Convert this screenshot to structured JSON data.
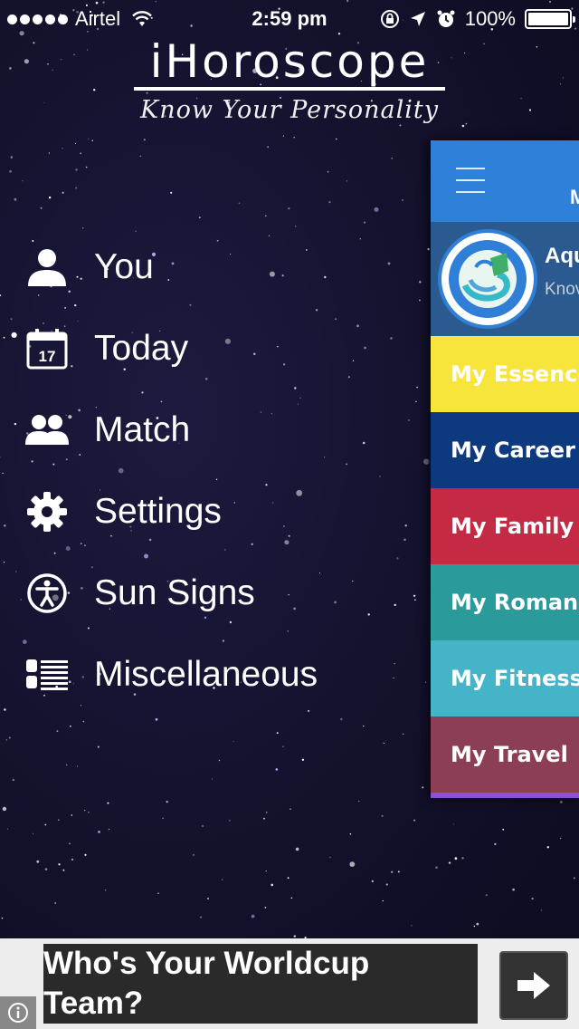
{
  "status_bar": {
    "carrier": "Airtel",
    "time": "2:59 pm",
    "battery": "100%"
  },
  "app": {
    "title": "iHoroscope",
    "tagline": "Know Your Personality"
  },
  "menu": {
    "items": [
      {
        "label": "You",
        "icon": "person-icon"
      },
      {
        "label": "Today",
        "icon": "calendar-icon",
        "icon_text": "17"
      },
      {
        "label": "Match",
        "icon": "people-icon"
      },
      {
        "label": "Settings",
        "icon": "gear-icon"
      },
      {
        "label": "Sun Signs",
        "icon": "accessibility-icon"
      },
      {
        "label": "Miscellaneous",
        "icon": "list-icon"
      }
    ]
  },
  "panel": {
    "header_text": "M",
    "sign_name": "Aqu",
    "sign_subtitle": "Knov",
    "header_color": "#2f80d8",
    "categories": [
      {
        "label": "My Essence",
        "bg": "#f7e53b",
        "fg": "#ffffff"
      },
      {
        "label": "My Career",
        "bg": "#0d3a7e",
        "fg": "#ffffff"
      },
      {
        "label": "My Family",
        "bg": "#c42a44",
        "fg": "#ffffff"
      },
      {
        "label": "My Romance",
        "bg": "#2a9a9a",
        "fg": "#ffffff"
      },
      {
        "label": "My Fitness",
        "bg": "#45b4c9",
        "fg": "#ffffff"
      },
      {
        "label": "My Travel",
        "bg": "#8c3e55",
        "fg": "#ffffff"
      }
    ],
    "bottom_color": "#8e4fd6"
  },
  "ad": {
    "text": "Who's Your Worldcup Team?"
  }
}
